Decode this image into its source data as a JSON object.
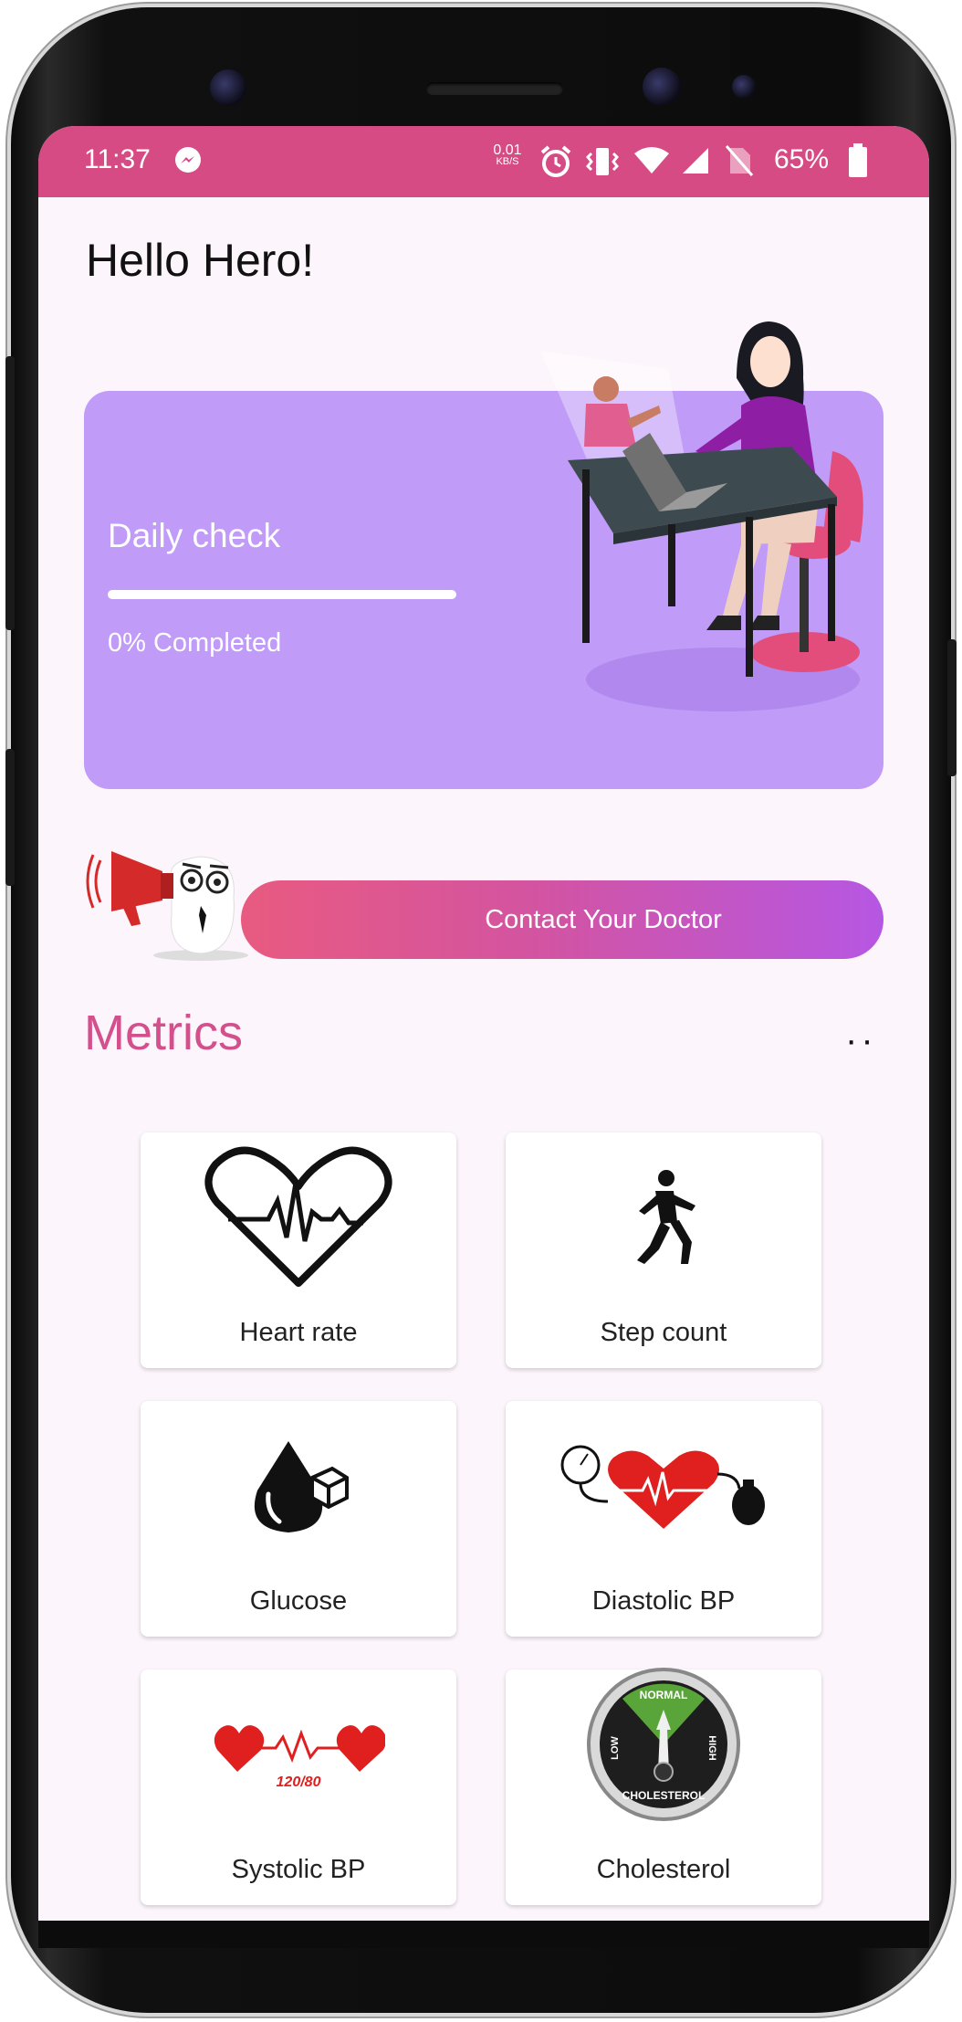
{
  "status_bar": {
    "time": "11:37",
    "speed_value": "0.01",
    "speed_unit": "KB/S",
    "battery": "65%"
  },
  "greeting": "Hello Hero!",
  "daily_check": {
    "title": "Daily check",
    "progress_fraction": 0,
    "completed_text": "0% Completed"
  },
  "contact_button": "Contact Your Doctor",
  "metrics": {
    "title": "Metrics",
    "tiles": [
      {
        "label": "Heart rate",
        "icon": "heart-rate-icon"
      },
      {
        "label": "Step count",
        "icon": "walking-person-icon"
      },
      {
        "label": "Glucose",
        "icon": "glucose-drop-icon"
      },
      {
        "label": "Diastolic BP",
        "icon": "blood-pressure-gauge-icon"
      },
      {
        "label": "Systolic BP",
        "icon": "hearts-pulse-icon"
      },
      {
        "label": "Cholesterol",
        "icon": "cholesterol-meter-icon"
      }
    ],
    "systolic_icon_text": "120/80",
    "cholesterol_gauge": {
      "top": "NORMAL",
      "left": "LOW",
      "right": "HIGH",
      "bottom": "CHOLESTEROL"
    }
  },
  "colors": {
    "status_bar": "#d64b84",
    "card": "#c09bf7",
    "accent": "#d3508d"
  }
}
